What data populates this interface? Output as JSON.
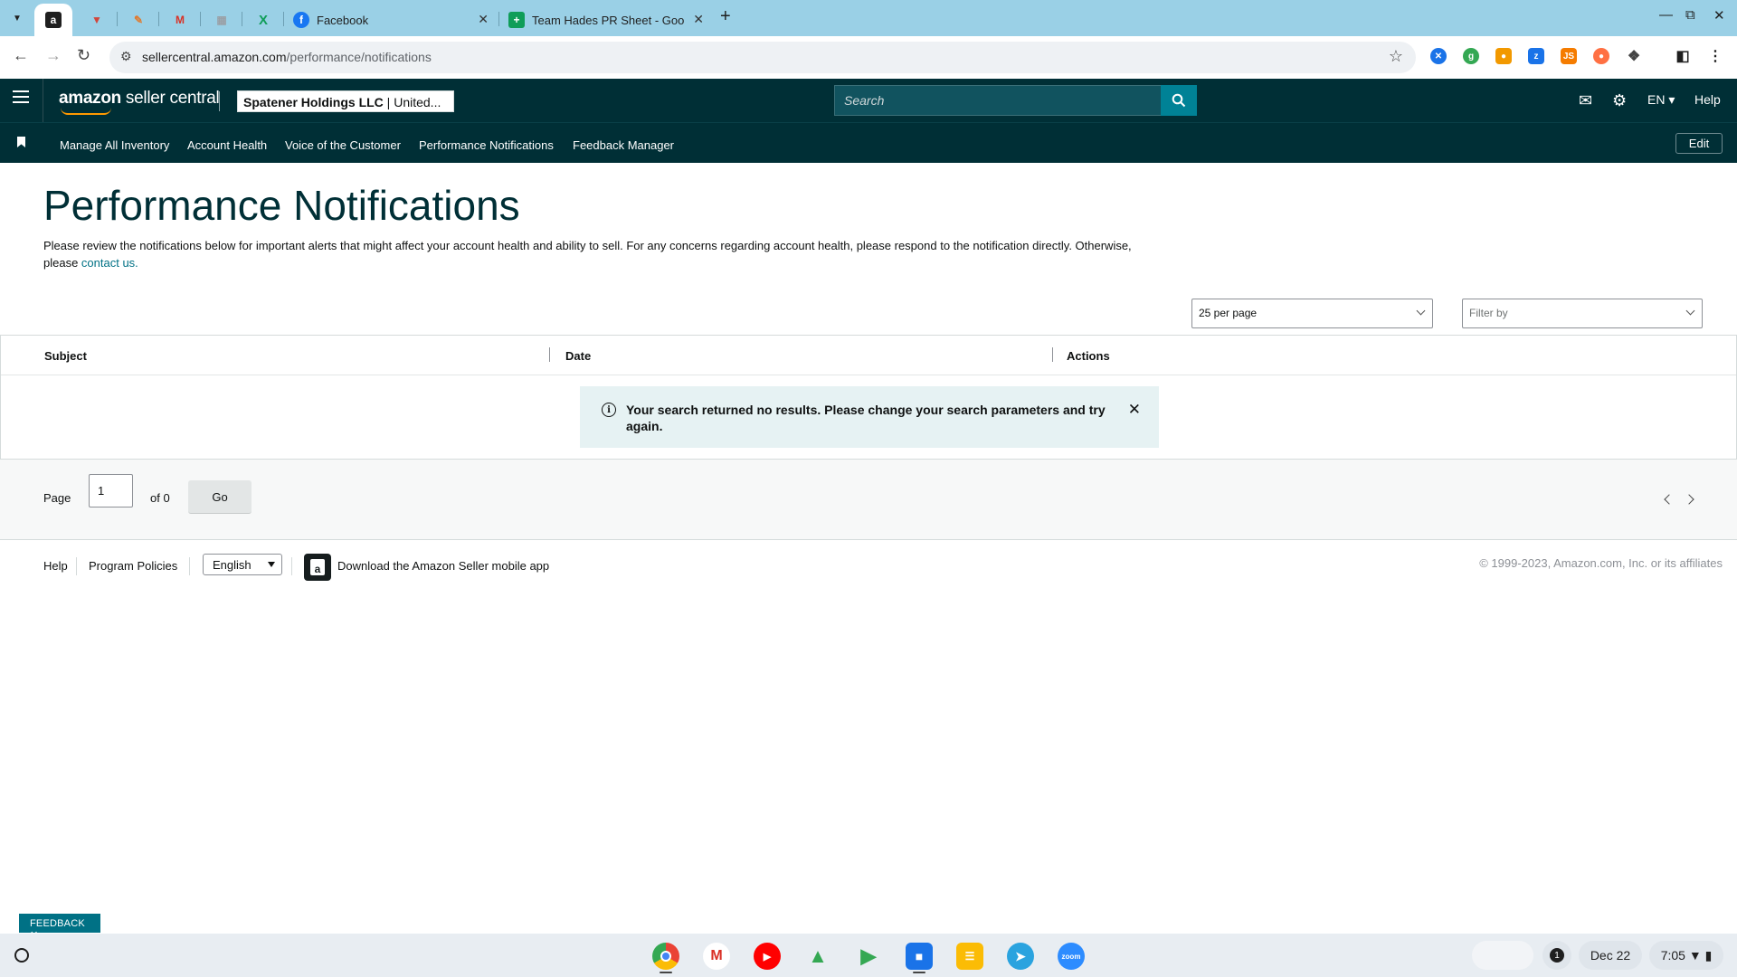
{
  "browser": {
    "tabs": [
      {
        "icon": "amazon-icon",
        "title": "",
        "active": true
      },
      {
        "icon": "todoist-icon",
        "title": ""
      },
      {
        "icon": "pen-app-icon",
        "title": ""
      },
      {
        "icon": "gmail-icon",
        "title": ""
      },
      {
        "icon": "calendar-icon",
        "title": ""
      },
      {
        "icon": "x-icon",
        "title": ""
      },
      {
        "icon": "facebook-icon",
        "title": "Facebook"
      },
      {
        "icon": "sheets-icon",
        "title": "Team Hades PR Sheet - Google"
      }
    ],
    "url_domain": "sellercentral.amazon.com",
    "url_path": "/performance/notifications"
  },
  "header": {
    "logo_amazon": "amazon",
    "logo_rest": " seller central",
    "account_name": "Spatener Holdings LLC",
    "account_region": " | United...",
    "search_placeholder": "Search",
    "language": "EN",
    "help": "Help"
  },
  "nav": {
    "items": [
      "Manage All Inventory",
      "Account Health",
      "Voice of the Customer",
      "Performance Notifications",
      "Feedback Manager"
    ],
    "edit": "Edit"
  },
  "main": {
    "title": "Performance Notifications",
    "description": "Please review the notifications below for important alerts that might affect your account health and ability to sell. For any concerns regarding account health, please respond to the notification directly. Otherwise, please ",
    "contact_link": "contact us.",
    "per_page": "25 per page",
    "filter_placeholder": "Filter by",
    "columns": [
      "Subject",
      "Date",
      "Actions"
    ],
    "alert": "Your search returned no results. Please change your search parameters and try again.",
    "pagination": {
      "page_label": "Page",
      "page_value": "1",
      "of_label": "of 0",
      "go": "Go"
    }
  },
  "footer": {
    "help": "Help",
    "program_policies": "Program Policies",
    "language": "English",
    "download_app": "Download the Amazon Seller mobile app",
    "copyright": "© 1999-2023, Amazon.com, Inc. or its affiliates"
  },
  "feedback_button": "FEEDBACK",
  "shelf": {
    "notification_count": "1",
    "date": "Dec 22",
    "time": "7:05"
  },
  "colors": {
    "header_bg": "#002f36",
    "search_button": "#008296",
    "link": "#007185",
    "alert_bg": "#e6f2f3",
    "tabbar_bg": "#9ad0e6"
  }
}
